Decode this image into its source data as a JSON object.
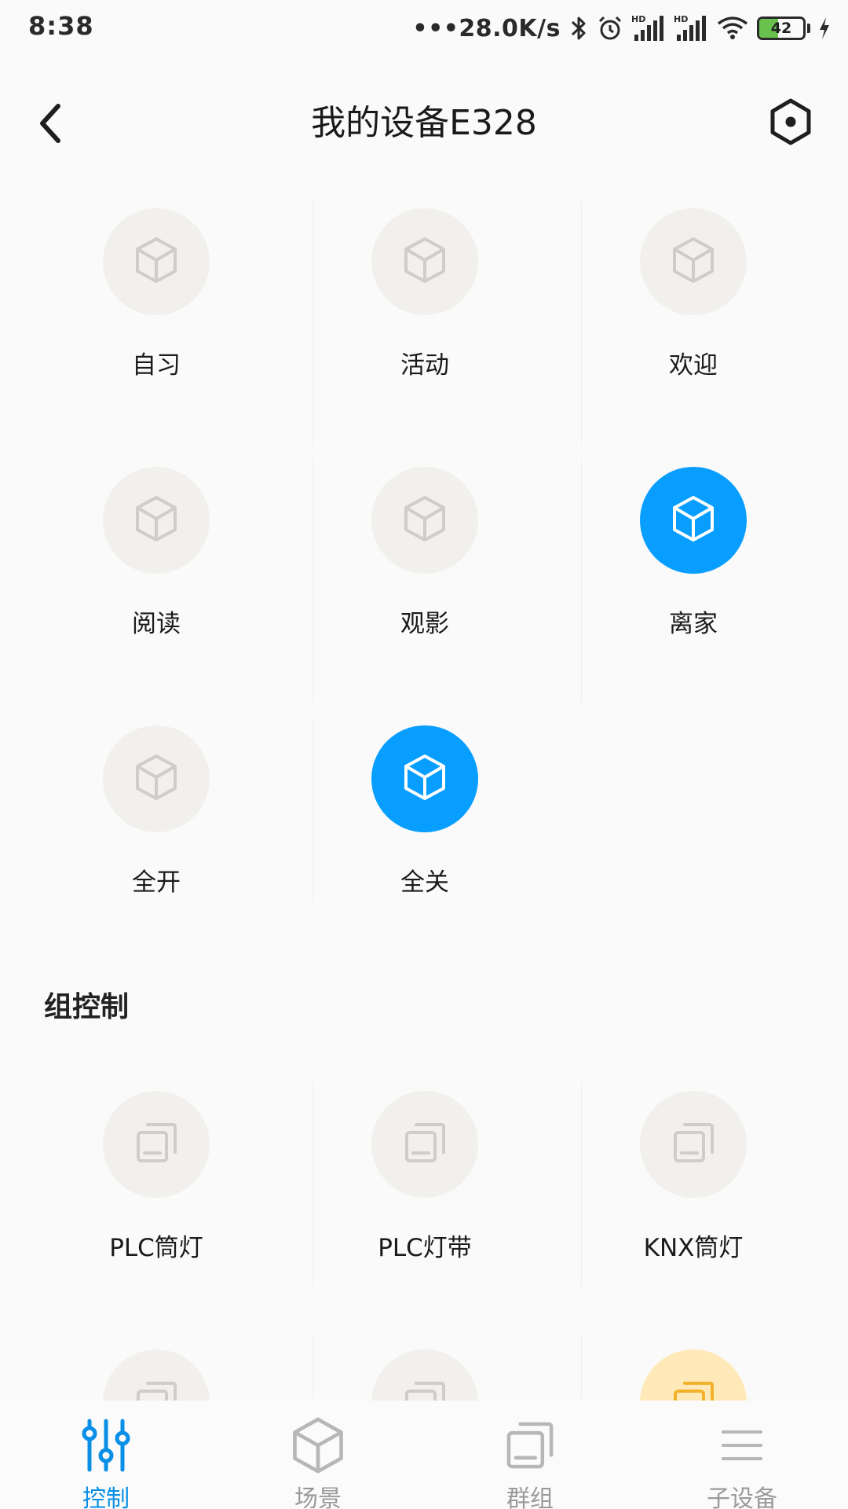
{
  "status_bar": {
    "time": "8:38",
    "net_speed": "•••28.0K/s",
    "battery_level": "42",
    "battery_fraction": 0.42,
    "icons": [
      "bluetooth-icon",
      "alarm-icon",
      "signal-hd-icon",
      "signal-hd-icon",
      "wifi-icon",
      "battery-icon",
      "charging-icon"
    ]
  },
  "header": {
    "title": "我的设备E328",
    "back_icon": "chevron-left-icon",
    "settings_icon": "hexagon-settings-icon"
  },
  "scenes": [
    {
      "label": "自习",
      "active": false
    },
    {
      "label": "活动",
      "active": false
    },
    {
      "label": "欢迎",
      "active": false
    },
    {
      "label": "阅读",
      "active": false
    },
    {
      "label": "观影",
      "active": false
    },
    {
      "label": "离家",
      "active": true
    },
    {
      "label": "全开",
      "active": false
    },
    {
      "label": "全关",
      "active": true
    }
  ],
  "group_section": {
    "title": "组控制",
    "groups": [
      {
        "label": "PLC筒灯",
        "state": "off"
      },
      {
        "label": "PLC灯带",
        "state": "off"
      },
      {
        "label": "KNX筒灯",
        "state": "off"
      },
      {
        "label": "",
        "state": "off"
      },
      {
        "label": "",
        "state": "off"
      },
      {
        "label": "",
        "state": "on"
      }
    ]
  },
  "bottom_nav": {
    "items": [
      {
        "label": "控制",
        "icon": "sliders-icon",
        "active": true
      },
      {
        "label": "场景",
        "icon": "cube-icon",
        "active": false
      },
      {
        "label": "群组",
        "icon": "stacked-squares-icon",
        "active": false
      },
      {
        "label": "子设备",
        "icon": "menu-lines-icon",
        "active": false
      }
    ]
  },
  "colors": {
    "accent": "#089eff",
    "inactive_circle": "#f2f0ec",
    "warm_circle": "#ffe9b8",
    "nav_active": "#0a8fe6",
    "nav_inactive": "#9a9a9a"
  }
}
